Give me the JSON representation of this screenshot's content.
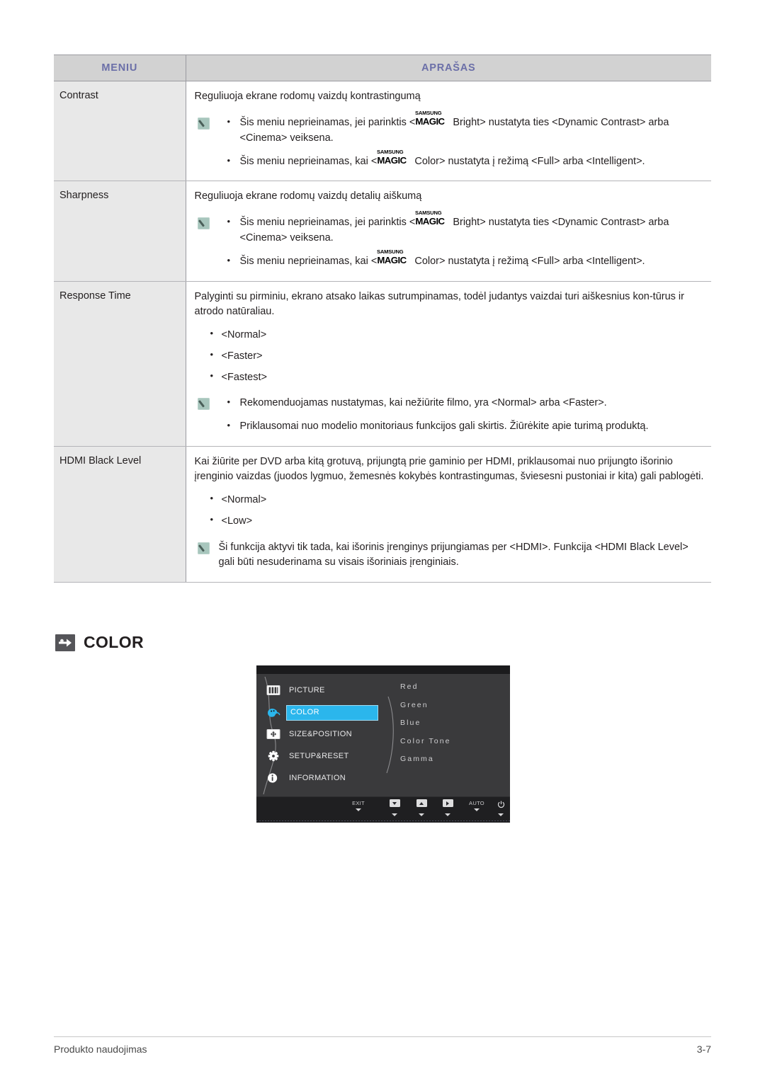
{
  "table": {
    "headers": {
      "menu": "MENIU",
      "description": "APRAŠAS"
    },
    "header_color": "#6b6fa8",
    "rows": [
      {
        "menu": "Contrast",
        "lead": "Reguliuoja ekrane rodomų vaizdų kontrastingumą",
        "notes": [
          {
            "pre": "Šis meniu neprieinamas, jei parinktis <",
            "logo_top": "SAMSUNG",
            "logo_bottom": "MAGIC",
            "post": "Bright> nustatyta ties <Dynamic Contrast> arba <Cinema> veiksena."
          },
          {
            "pre": "Šis meniu neprieinamas, kai <",
            "logo_top": "SAMSUNG",
            "logo_bottom": "MAGIC",
            "post": "Color> nustatyta į režimą <Full> arba <Intelligent>."
          }
        ]
      },
      {
        "menu": "Sharpness",
        "lead": "Reguliuoja ekrane rodomų vaizdų detalių aiškumą",
        "notes": [
          {
            "pre": "Šis meniu neprieinamas, jei parinktis <",
            "logo_top": "SAMSUNG",
            "logo_bottom": "MAGIC",
            "post": "Bright> nustatyta ties <Dynamic Contrast> arba <Cinema> veiksena."
          },
          {
            "pre": "Šis meniu neprieinamas, kai <",
            "logo_top": "SAMSUNG",
            "logo_bottom": "MAGIC",
            "post": "Color> nustatyta į režimą <Full> arba <Intelligent>."
          }
        ]
      },
      {
        "menu": "Response Time",
        "lead": "Palyginti su pirminiu, ekrano atsako laikas sutrumpinamas, todėl judantys vaizdai turi aiškesnius kon-tūrus ir atrodo natūraliau.",
        "options": [
          "<Normal>",
          "<Faster>",
          "<Fastest>"
        ],
        "notes_plain": [
          "Rekomenduojamas nustatymas, kai nežiūrite filmo, yra <Normal> arba <Faster>.",
          "Priklausomai nuo modelio monitoriaus funkcijos gali skirtis. Žiūrėkite apie turimą produktą."
        ]
      },
      {
        "menu": "HDMI Black Level",
        "lead": "Kai žiūrite per DVD arba kitą grotuvą, prijungtą prie gaminio per HDMI, priklausomai nuo prijungto išorinio įrenginio vaizdas (juodos lygmuo, žemesnės kokybės kontrastingumas, šviesesni pustoniai ir kita) gali pablogėti.",
        "options": [
          "<Normal>",
          "<Low>"
        ],
        "note_paragraph": "Ši funkcija aktyvi tik tada, kai išorinis įrenginys prijungiamas per <HDMI>. Funkcija <HDMI Black Level> gali būti nesuderinama su visais išoriniais įrenginiais."
      }
    ]
  },
  "section": {
    "title": "COLOR",
    "icon": "navigation-arrow-icon"
  },
  "osd": {
    "menu_items": [
      {
        "label": "PICTURE",
        "icon": "picture-icon",
        "selected": false
      },
      {
        "label": "COLOR",
        "icon": "color-icon",
        "selected": true
      },
      {
        "label": "SIZE&POSITION",
        "icon": "size-position-icon",
        "selected": false
      },
      {
        "label": "SETUP&RESET",
        "icon": "gear-icon",
        "selected": false
      },
      {
        "label": "INFORMATION",
        "icon": "info-icon",
        "selected": false
      }
    ],
    "submenu_items": [
      "Red",
      "Green",
      "Blue",
      "Color Tone",
      "Gamma"
    ],
    "buttons": [
      {
        "label": "EXIT",
        "icon": "text"
      },
      {
        "label": "",
        "icon": "down"
      },
      {
        "label": "",
        "icon": "up"
      },
      {
        "label": "",
        "icon": "right"
      },
      {
        "label": "AUTO",
        "icon": "text"
      },
      {
        "label": "",
        "icon": "power"
      }
    ],
    "highlight_color": "#2bb6ec"
  },
  "footer": {
    "left": "Produkto naudojimas",
    "right": "3-7"
  }
}
